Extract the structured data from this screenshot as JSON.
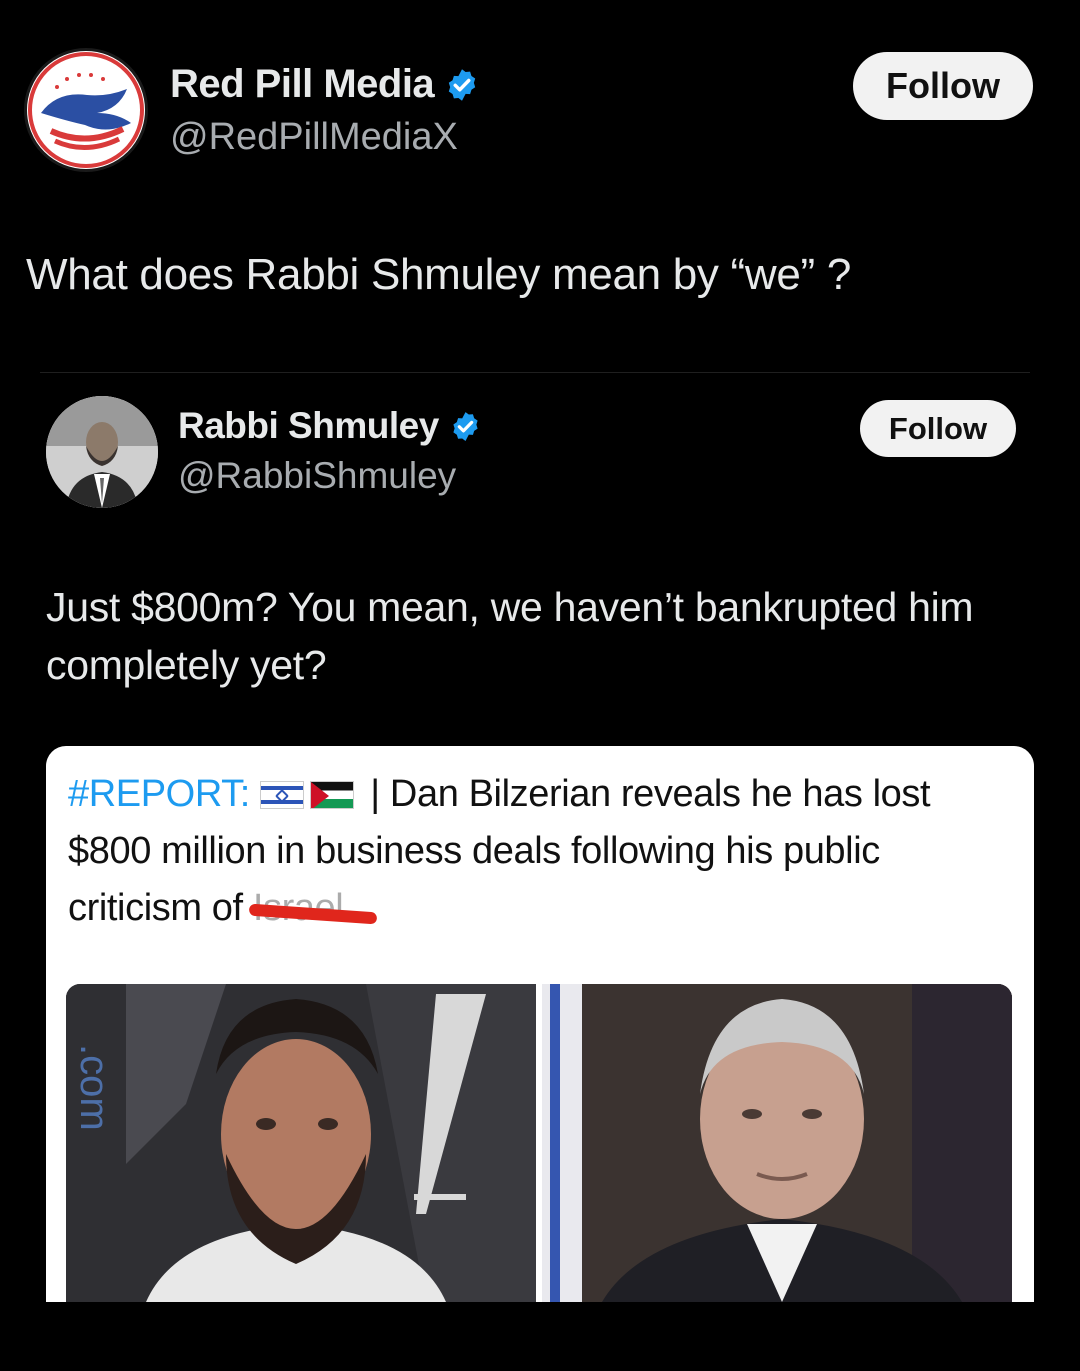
{
  "main_post": {
    "author_name": "Red Pill Media",
    "handle": "@RedPillMediaX",
    "follow_label": "Follow",
    "text": "What does Rabbi Shmuley mean by “we” ?"
  },
  "quoted_post": {
    "author_name": "Rabbi Shmuley",
    "handle": "@RabbiShmuley",
    "follow_label": "Follow",
    "text": "Just $800m? You mean, we haven’t bankrupted him completely yet?"
  },
  "embedded_card": {
    "hashtag": "#REPORT:",
    "flags": [
      "israel-flag",
      "palestine-flag"
    ],
    "headline_after_flags": " | Dan Bilzerian reveals he has lost $800 million in business deals following his public criticism of ",
    "redacted_word": "Israel",
    "photo_left_text": ".com"
  },
  "colors": {
    "background": "#000000",
    "verified_badge": "#1d9bf0",
    "hashtag": "#1d9bf0",
    "redaction": "#e0261c"
  }
}
